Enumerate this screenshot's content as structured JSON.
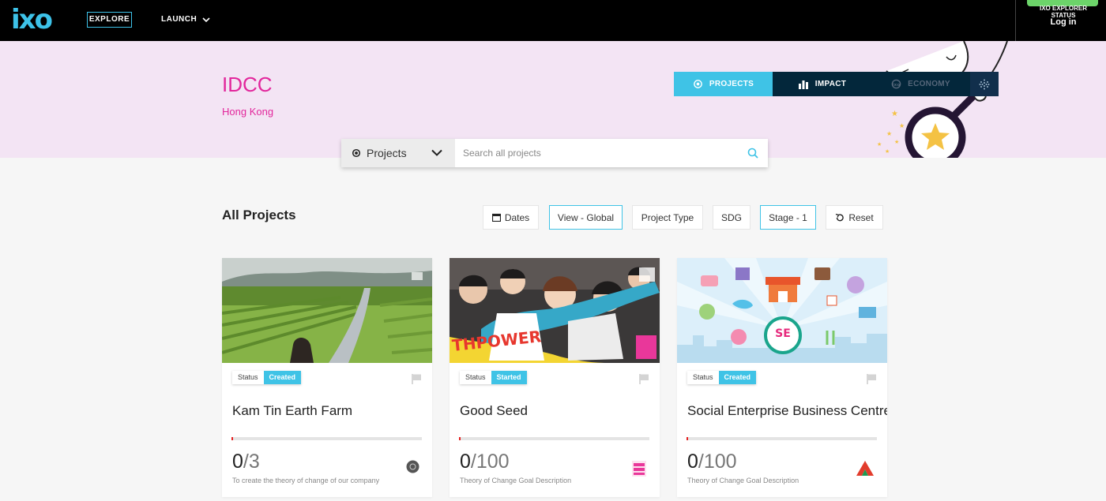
{
  "topbar": {
    "logo": "ixo",
    "explore_label": "EXPLORE",
    "launch_label": "LAUNCH",
    "explorer_label": "IXO EXPLORER",
    "status_label": "STATUS",
    "login_label": "Log in",
    "status_color": "#6cd46a"
  },
  "header": {
    "title": "IDCC",
    "subtitle": "Hong Kong",
    "background": "#f3e4f4",
    "accent": "#e2279c"
  },
  "tabs": [
    {
      "label": "PROJECTS",
      "icon": "gear-icon",
      "active": true
    },
    {
      "label": "IMPACT",
      "icon": "bar-chart-icon",
      "active": false
    },
    {
      "label": "ECONOMY",
      "icon": "coin-icon",
      "active": false
    }
  ],
  "search": {
    "select_label": "Projects",
    "placeholder": "Search all projects"
  },
  "list": {
    "heading": "All Projects",
    "filters": [
      "Dates",
      "View - Global",
      "Project Type",
      "SDG",
      "Stage - 1",
      "Reset"
    ]
  },
  "cards": [
    {
      "status_label": "Status",
      "status_value": "Created",
      "title": "Kam Tin Earth Farm",
      "count": "0",
      "total": "/3",
      "description": "To create the theory of change of our company",
      "progress": 0.01
    },
    {
      "status_label": "Status",
      "status_value": "Started",
      "title": "Good Seed",
      "count": "0",
      "total": "/100",
      "description": "Theory of Change Goal Description",
      "progress": 0.01
    },
    {
      "status_label": "Status",
      "status_value": "Created",
      "title": "Social Enterprise Business Centre",
      "count": "0",
      "total": "/100",
      "description": "Theory of Change Goal Description",
      "progress": 0.01,
      "image_badge": "SE"
    }
  ],
  "colors": {
    "brand": "#3dc2e8",
    "tab_bar": "#03273b",
    "progress": "#e52222"
  }
}
